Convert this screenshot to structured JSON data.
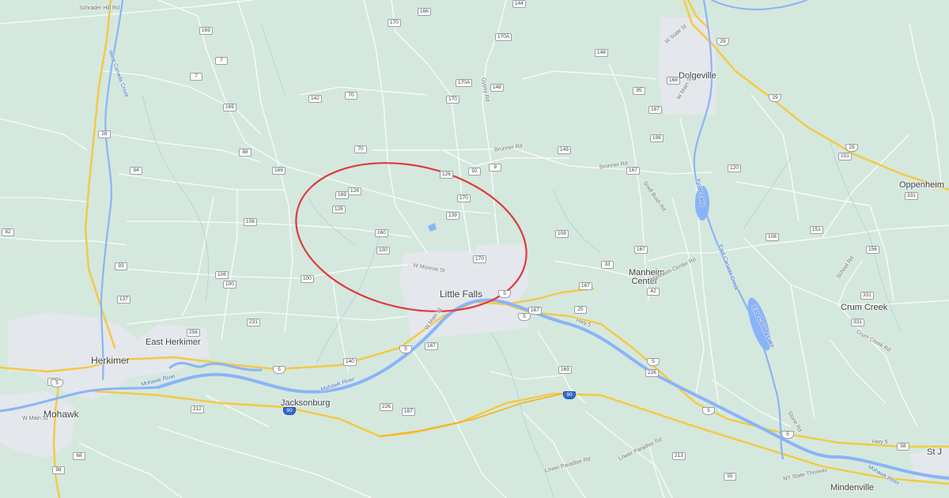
{
  "map": {
    "colors": {
      "land": "#d5e8dd",
      "urban": "#e4e7eb",
      "highway": "#f5c842",
      "river": "#8ab4f8",
      "minor_road": "#ffffff",
      "annotation": "#e0393e"
    },
    "annotation": "red-circle-around-little-falls",
    "places": {
      "little_falls": "Little Falls",
      "herkimer": "Herkimer",
      "east_herkimer": "East Herkimer",
      "mohawk": "Mohawk",
      "jacksonburg": "Jacksonburg",
      "manheim_center": "Manheim Center",
      "dolgeville": "Dolgeville",
      "oppenheim": "Oppenheim",
      "crum_creek": "Crum Creek",
      "mindenville": "Mindenville",
      "st_j": "St J"
    },
    "water": {
      "mohawk_river_1": "Mohawk River",
      "mohawk_river_2": "Mohawk River",
      "mohawk_river_3": "Mohawk River",
      "kyser_lake": "Kyser Lake",
      "east_canada_creek": "East Canada Creek",
      "east_canada_lake": "East Canada Lake",
      "west_canada_creek": "West Canada Creek"
    },
    "roads": {
      "schrader_hill": "Schrader Hill Rd",
      "w_monroe": "W Monroe St",
      "w_main": "W Main St",
      "hwy5_a": "Hwy 5",
      "hwy5_b": "Hwy 5",
      "brunner": "Brunner Rd",
      "bronner": "Bronner Rd",
      "snell_bush": "Snell Bush Rd",
      "manheim_ctr_rd": "Manheim Center Rd",
      "lower_paradise_1": "Lower Paradise Rd",
      "lower_paradise_2": "Lower Paradise Rd",
      "ny_thruway": "NY State Thruway",
      "w_main_mohawk": "W Main St",
      "w_state": "W State St",
      "w_main_dolge": "W Main St",
      "crum_creek_rd": "Crum Creek Rd",
      "school_rd": "School Rd",
      "stone_rd": "Stone Rd",
      "gypsy_rd": "Gypsy Rd"
    },
    "shields": {
      "s166": "166",
      "s144": "144",
      "s170a1": "170A",
      "s170_top": "170",
      "s169a": "169",
      "s148a": "148",
      "s7a": "7",
      "s7b": "7",
      "s170a2": "170A",
      "s148b": "148",
      "s170b": "170",
      "s142": "142",
      "s70a": "70",
      "s169b": "169",
      "s88": "88",
      "s70b": "70",
      "s169c": "169",
      "s126a": "126",
      "s92": "92",
      "s9": "9",
      "s126b": "126",
      "s169d": "169",
      "s126c": "126",
      "s170c": "170",
      "s139": "139",
      "s106": "106",
      "s160": "160",
      "s100a": "100",
      "s170d": "170",
      "s100b": "100",
      "s106b": "106",
      "s100c": "100",
      "s231": "231",
      "s140": "140",
      "s5a": "5",
      "s5b": "5",
      "s5c": "5",
      "s167a": "167",
      "s167b": "167",
      "s226": "226",
      "s167c": "167",
      "s169e": "169",
      "s90": "90",
      "s66": "66",
      "s212": "212",
      "s5d": "5",
      "s5e": "5",
      "s5f": "5",
      "s28": "28",
      "s137": "137",
      "s93": "93",
      "s94": "94",
      "s82": "82",
      "s68": "68",
      "s98": "98",
      "s95": "95",
      "s167d": "167",
      "s168": "168",
      "s196": "196",
      "s149": "149",
      "s167e": "167",
      "s167f": "167",
      "s109": "109",
      "s33": "33",
      "s42": "42",
      "s167g": "167",
      "s120": "120",
      "s108": "108",
      "s151a": "151",
      "s29a": "29",
      "s29b": "29",
      "s29c": "29",
      "s331": "331",
      "s151b": "151",
      "s156": "156",
      "s331b": "331",
      "s331c": "331",
      "s5g": "5",
      "s5h": "5",
      "s226b": "226",
      "s90b": "90",
      "s55": "55",
      "s213": "213",
      "s58": "58",
      "s256": "256",
      "s25": "25"
    }
  }
}
